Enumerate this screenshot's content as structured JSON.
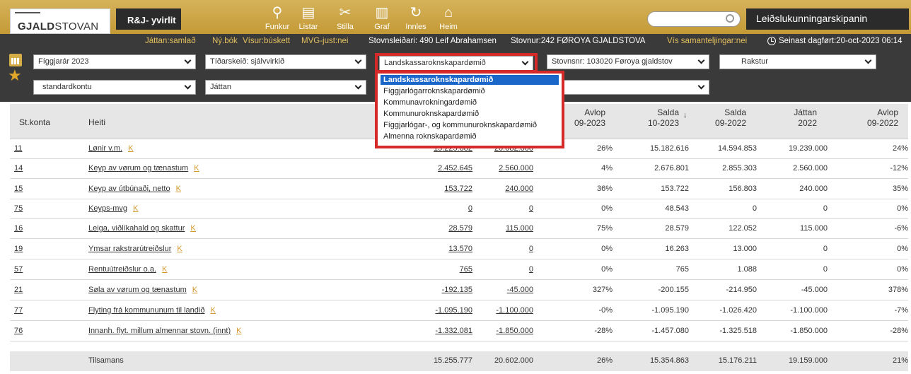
{
  "app": {
    "logo_bold": "GJALD",
    "logo_rest": "STOVAN",
    "title": "R&J- yvirlit",
    "user_label": "Leiðslukunningarskipanin",
    "search_placeholder": ""
  },
  "nav": [
    {
      "label": "Funkur",
      "icon": "search-icon",
      "glyph": "⚲"
    },
    {
      "label": "Listar",
      "icon": "list-icon",
      "glyph": "▤"
    },
    {
      "label": "Stilla",
      "icon": "tools-icon",
      "glyph": "✂"
    },
    {
      "label": "Graf",
      "icon": "chart-icon",
      "glyph": "▥"
    },
    {
      "label": "Innles",
      "icon": "refresh-icon",
      "glyph": "↻"
    },
    {
      "label": "Heim",
      "icon": "home-icon",
      "glyph": "⌂"
    }
  ],
  "info": {
    "jattan": "Játtan:samlað",
    "nybok": "Ný.bók",
    "visur": "Vísur:búskett",
    "mvg": "MVG-just:nei",
    "stovnsleidari": "Stovnsleiðari: 490 Leif Abrahamsen",
    "stovnur": "Stovnur:242 FØROYA GJALDSTOVA",
    "vis_saman": "Vís samanteljingar:nei",
    "dagfort": "Seinast dagført:20-oct-2023 06:14"
  },
  "filters": {
    "figgjarar": "Fíggjarár 2023",
    "tidarskeid": "Tíðarskeið: sjálvvirkið",
    "rokn": "Landskassaroknskapardømið",
    "stovnsnr": "Stovnsnr: 103020 Føroya gjaldstov",
    "rakstur": "Rakstur",
    "kontu": "standardkontu",
    "jattan": "Játtan"
  },
  "dropdown_options": [
    "Landskassaroknskapardømið",
    "Fíggjarlógarroknskapardømið",
    "Kommunavrokningardømið",
    "Kommunuroknskapardømið",
    "Fíggjarlógar-, og kommunuroknskapardømið",
    "Almenna roknskapardømið"
  ],
  "table": {
    "headers": {
      "stkonta": "St.konta",
      "heiti": "Heiti",
      "avlop1_a": "Avlop",
      "avlop1_b": "09-2023",
      "salda1_a": "Salda",
      "salda1_b": "10-2023",
      "salda2_a": "Salda",
      "salda2_b": "09-2022",
      "jattan_a": "Játtan",
      "jattan_b": "2022",
      "avlop2_a": "Avlop",
      "avlop2_b": "09-2022"
    },
    "k": "K",
    "rows": [
      {
        "konta": "11",
        "heiti": "Lønir v.m.",
        "v1": "15.225.882",
        "v2": "20.082.000",
        "avlop": "26%",
        "salda1": "15.182.616",
        "salda2": "14.594.853",
        "jattan": "19.239.000",
        "avlop2": "24%"
      },
      {
        "konta": "14",
        "heiti": "Keyp av vørum og tænastum",
        "v1": "2.452.645",
        "v2": "2.560.000",
        "avlop": "4%",
        "salda1": "2.676.801",
        "salda2": "2.855.303",
        "jattan": "2.560.000",
        "avlop2": "-12%"
      },
      {
        "konta": "15",
        "heiti": "Keyp av útbúnaði, netto",
        "v1": "153.722",
        "v2": "240.000",
        "avlop": "36%",
        "salda1": "153.722",
        "salda2": "156.803",
        "jattan": "240.000",
        "avlop2": "35%"
      },
      {
        "konta": "75",
        "heiti": "Keyps-mvg",
        "v1": "0",
        "v2": "0",
        "avlop": "0%",
        "salda1": "48.543",
        "salda2": "0",
        "jattan": "0",
        "avlop2": "0%"
      },
      {
        "konta": "16",
        "heiti": "Leiga, viðlíkahald og skattur",
        "v1": "28.579",
        "v2": "115.000",
        "avlop": "75%",
        "salda1": "28.579",
        "salda2": "122.052",
        "jattan": "115.000",
        "avlop2": "-6%"
      },
      {
        "konta": "19",
        "heiti": "Ymsar rakstrarútreiðslur",
        "v1": "13.570",
        "v2": "0",
        "avlop": "0%",
        "salda1": "16.263",
        "salda2": "13.000",
        "jattan": "0",
        "avlop2": "0%"
      },
      {
        "konta": "57",
        "heiti": "Rentuútreiðslur o.a.",
        "v1": "765",
        "v2": "0",
        "avlop": "0%",
        "salda1": "765",
        "salda2": "1.088",
        "jattan": "0",
        "avlop2": "0%"
      },
      {
        "konta": "21",
        "heiti": "Søla av vørum og tænastum",
        "v1": "-192.135",
        "v2": "-45.000",
        "avlop": "327%",
        "salda1": "-200.155",
        "salda2": "-214.950",
        "jattan": "-45.000",
        "avlop2": "378%"
      },
      {
        "konta": "77",
        "heiti": "Flyting frá kommununum til landið",
        "v1": "-1.095.190",
        "v2": "-1.100.000",
        "avlop": "-0%",
        "salda1": "-1.095.190",
        "salda2": "-1.026.420",
        "jattan": "-1.100.000",
        "avlop2": "-7%"
      },
      {
        "konta": "76",
        "heiti": "Innanh. flyt. millum almennar stovn. (innt)",
        "v1": "-1.332.081",
        "v2": "-1.850.000",
        "avlop": "-28%",
        "salda1": "-1.457.080",
        "salda2": "-1.325.518",
        "jattan": "-1.850.000",
        "avlop2": "-28%"
      }
    ],
    "total": {
      "label": "Tilsamans",
      "v1": "15.255.777",
      "v2": "20.602.000",
      "avlop": "26%",
      "salda1": "15.354.863",
      "salda2": "15.176.211",
      "jattan": "19.159.000",
      "avlop2": "21%"
    }
  }
}
